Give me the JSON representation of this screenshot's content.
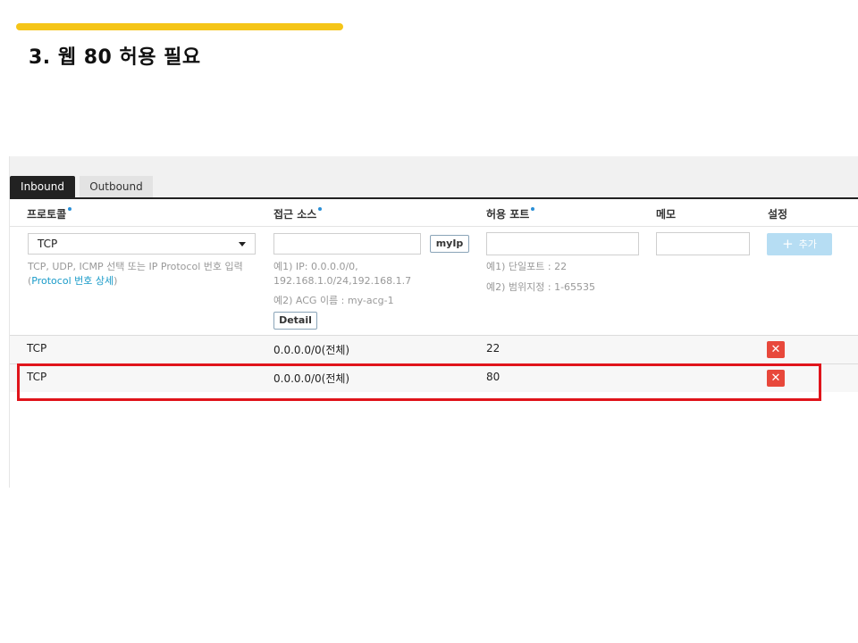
{
  "slide": {
    "title": "3. 웹 80 허용 필요"
  },
  "tabs": [
    {
      "label": "Inbound",
      "active": true
    },
    {
      "label": "Outbound",
      "active": false
    }
  ],
  "columns": {
    "protocol": "프로토콜",
    "source": "접근 소스",
    "port": "허용 포트",
    "memo": "메모",
    "settings": "설정"
  },
  "form": {
    "protocol_value": "TCP",
    "protocol_hint": "TCP, UDP, ICMP 선택 또는 IP Protocol 번호 입력",
    "protocol_hint_link_open": "(",
    "protocol_hint_link": "Protocol 번호 상세",
    "protocol_hint_link_close": ")",
    "source_value": "",
    "myip_label": "myIp",
    "source_hint1_line1": "예1) IP: 0.0.0.0/0,",
    "source_hint1_line2": "192.168.1.0/24,192.168.1.7",
    "source_hint2": "예2) ACG 이름 : my-acg-1",
    "detail_label": "Detail",
    "port_value": "",
    "port_hint1": "예1) 단일포트 : 22",
    "port_hint2": "예2) 범위지정 : 1-65535",
    "memo_value": "",
    "add_label": "추가"
  },
  "rules": [
    {
      "protocol": "TCP",
      "source": "0.0.0.0/0(전체)",
      "port": "22",
      "delete_icon": "✕"
    },
    {
      "protocol": "TCP",
      "source": "0.0.0.0/0(전체)",
      "port": "80",
      "delete_icon": "✕"
    }
  ],
  "colors": {
    "accent": "#f5c518",
    "highlight": "#e0141b",
    "delete": "#e8483b",
    "required_dot": "#2b8fd6",
    "add_button": "#b6ddf3"
  }
}
